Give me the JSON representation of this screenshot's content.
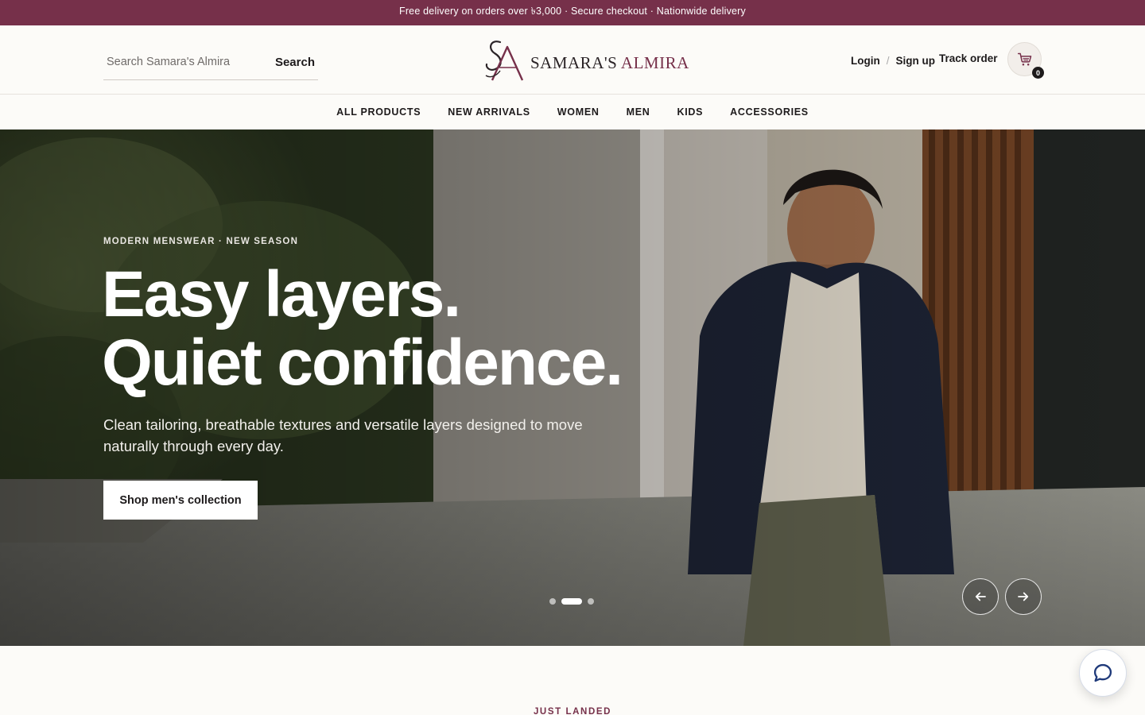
{
  "announcement": "Free delivery on orders over ৳3,000 · Secure checkout · Nationwide delivery",
  "search": {
    "placeholder": "Search Samara's Almira",
    "button_label": "Search"
  },
  "logo": {
    "text_primary": "SAMARA'S",
    "text_accent": "ALMIRA",
    "monogram": "SA"
  },
  "account": {
    "login": "Login",
    "separator": "/",
    "signup": "Sign up",
    "track_order": "Track order"
  },
  "cart": {
    "count": "0",
    "icon": "cart-icon"
  },
  "nav": {
    "items": [
      "ALL PRODUCTS",
      "NEW ARRIVALS",
      "WOMEN",
      "MEN",
      "KIDS",
      "ACCESSORIES"
    ]
  },
  "hero": {
    "eyebrow": "MODERN MENSWEAR · NEW SEASON",
    "headline_line1": "Easy layers.",
    "headline_line2": "Quiet confidence.",
    "subtext": "Clean tailoring, breathable textures and versatile layers designed to move naturally through every day.",
    "cta_label": "Shop men's collection",
    "slides_total": 3,
    "active_slide": 2,
    "prev_icon": "arrow-left-icon",
    "next_icon": "arrow-right-icon"
  },
  "section": {
    "label": "JUST LANDED"
  },
  "chat": {
    "icon": "chat-bubble-icon"
  },
  "colors": {
    "brand": "#76304a",
    "text": "#1d1a1b",
    "background": "#fcfbf8"
  }
}
